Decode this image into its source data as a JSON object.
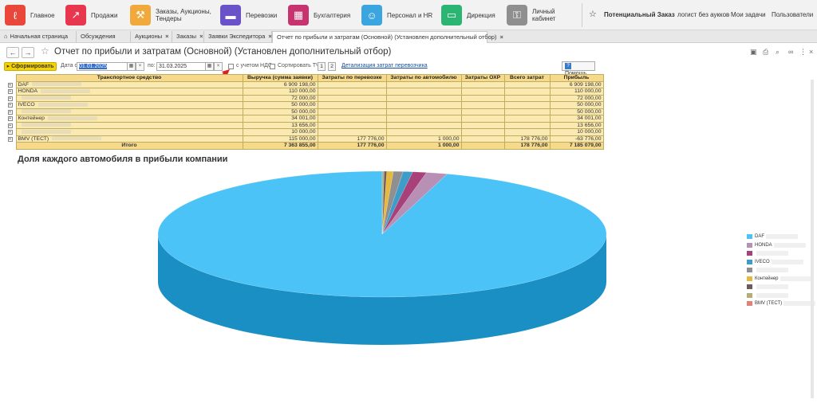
{
  "sections": [
    {
      "label": "Главное",
      "icon": "main-icon",
      "color": "#e8473a",
      "x": 6,
      "w": 70
    },
    {
      "label": "Продажи",
      "icon": "sales-chart-icon",
      "color": "#e8364f",
      "x": 82,
      "w": 74
    },
    {
      "label": "Заказы, Аукционы, Тендеры",
      "icon": "gavel-icon",
      "color": "#f1a93b",
      "x": 163,
      "w": 108
    },
    {
      "label": "Перевозки",
      "icon": "truck-icon",
      "color": "#6a52c8",
      "x": 276,
      "w": 80
    },
    {
      "label": "Бухгалтерия",
      "icon": "calculator-icon",
      "color": "#c8326e",
      "x": 361,
      "w": 88
    },
    {
      "label": "Персонал и HR",
      "icon": "badge-icon",
      "color": "#3aa5df",
      "x": 453,
      "w": 96
    },
    {
      "label": "Дирекция",
      "icon": "briefcase-icon",
      "color": "#2bb573",
      "x": 553,
      "w": 78
    },
    {
      "label": "Личный кабинет",
      "icon": "lock-icon",
      "color": "#8f8f8f",
      "x": 635,
      "w": 90
    }
  ],
  "right_links": {
    "star": "☆",
    "potential": "Потенциальный Заказ",
    "logist": "логист без аукков",
    "tasks": "Мои задачи",
    "users": "Пользователи"
  },
  "tabs": [
    {
      "label": "Начальная страница",
      "home": true,
      "close": false
    },
    {
      "label": "Обсуждения",
      "close": false
    },
    {
      "label": "Аукционы",
      "close": true
    },
    {
      "label": "Заказы",
      "close": true
    },
    {
      "label": "Заявки Экспедитора",
      "close": true
    },
    {
      "label": "Отчет по прибыли и затратам (Основной) (Установлен дополнительный отбор)",
      "close": true,
      "active": true
    }
  ],
  "report_title": "Отчет по прибыли и затратам (Основной) (Установлен дополнительный отбор)",
  "toolbar": {
    "generate": "Сформировать",
    "date_from_label": "Дата с:",
    "date_from": "01.01.2025",
    "date_to_label": "по:",
    "date_to": "31.03.2025",
    "vat_label": "с учетом НДС",
    "sort_label": "Сортировать ТЧ",
    "btn1": "1",
    "btn2": "2",
    "detail_link": "Детализация затрат перевозчика",
    "help": "Помощь"
  },
  "table": {
    "headers": [
      "Транспортное средство",
      "Выручка (сумма заявки)",
      "Затраты по перевозке",
      "Затраты по автомобилю",
      "Затраты ОХР",
      "Всего затрат",
      "Прибыль"
    ],
    "rows": [
      {
        "name": "DAF",
        "revenue": "6 909 198,00",
        "transport": "",
        "car": "",
        "ohr": "",
        "total": "",
        "profit": "6 909 198,00"
      },
      {
        "name": "HONDA",
        "revenue": "110 000,00",
        "transport": "",
        "car": "",
        "ohr": "",
        "total": "",
        "profit": "110 000,00"
      },
      {
        "name": "",
        "revenue": "72 000,00",
        "transport": "",
        "car": "",
        "ohr": "",
        "total": "",
        "profit": "72 000,00"
      },
      {
        "name": "IVECO",
        "revenue": "50 000,00",
        "transport": "",
        "car": "",
        "ohr": "",
        "total": "",
        "profit": "50 000,00"
      },
      {
        "name": "",
        "revenue": "50 000,00",
        "transport": "",
        "car": "",
        "ohr": "",
        "total": "",
        "profit": "50 000,00"
      },
      {
        "name": "Контейнер",
        "revenue": "34 001,00",
        "transport": "",
        "car": "",
        "ohr": "",
        "total": "",
        "profit": "34 001,00"
      },
      {
        "name": "",
        "revenue": "13 656,00",
        "transport": "",
        "car": "",
        "ohr": "",
        "total": "",
        "profit": "13 656,00"
      },
      {
        "name": "",
        "revenue": "10 000,00",
        "transport": "",
        "car": "",
        "ohr": "",
        "total": "",
        "profit": "10 000,00"
      },
      {
        "name": "BMV (ТЕСТ)",
        "revenue": "115 000,00",
        "transport": "177 776,00",
        "car": "1 000,00",
        "ohr": "",
        "total": "178 776,00",
        "profit": "-63 776,00"
      }
    ],
    "total": {
      "label": "Итого",
      "revenue": "7 363 855,00",
      "transport": "177 776,00",
      "car": "1 000,00",
      "ohr": "",
      "total": "178 776,00",
      "profit": "7 185 079,00"
    }
  },
  "chart_title": "Доля каждого автомобиля в прибыли компании",
  "chart_data": {
    "type": "pie",
    "title": "Доля каждого автомобиля в прибыли компании",
    "legend_position": "right",
    "series": [
      {
        "name": "DAF",
        "value": 6909198,
        "color": "#4cc3f7",
        "side": "#1a8fc4"
      },
      {
        "name": "HONDA",
        "value": 110000,
        "color": "#b88fb5",
        "side": "#8a678a"
      },
      {
        "name": "",
        "value": 72000,
        "color": "#a8407a",
        "side": "#7a2c58"
      },
      {
        "name": "IVECO",
        "value": 50000,
        "color": "#3e9cc9",
        "side": "#2a7399"
      },
      {
        "name": "",
        "value": 50000,
        "color": "#8f8f8f",
        "side": "#666666"
      },
      {
        "name": "Контейнер",
        "value": 34001,
        "color": "#e6b93c",
        "side": "#b48d22"
      },
      {
        "name": "",
        "value": 13656,
        "color": "#6e5a5a",
        "side": "#4d3e3e"
      },
      {
        "name": "",
        "value": 10000,
        "color": "#b3ad78",
        "side": "#8a8456"
      },
      {
        "name": "BMV (ТЕСТ)",
        "value": -63776,
        "color": "#e0827a",
        "side": "#b05d56"
      }
    ]
  }
}
